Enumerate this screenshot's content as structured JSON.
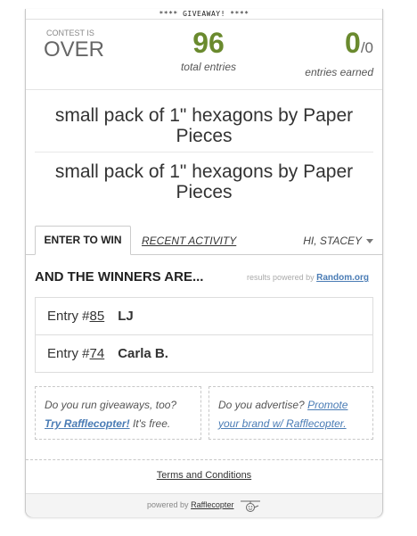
{
  "banner": "**** GIVEAWAY! ****",
  "stats": {
    "status_label": "CONTEST IS",
    "status_value": "OVER",
    "total_entries": "96",
    "total_label": "total entries",
    "earned_value": "0",
    "earned_of": "/0",
    "earned_label": "entries earned"
  },
  "prizes": [
    "small pack of 1\" hexagons by Paper Pieces",
    "small pack of 1\" hexagons by Paper Pieces"
  ],
  "tabs": {
    "enter": "ENTER TO WIN",
    "recent": "RECENT ACTIVITY",
    "user": "HI, STACEY"
  },
  "winners": {
    "title": "AND THE WINNERS ARE...",
    "powered_text": "results powered by",
    "powered_link": "Random.org",
    "entries": [
      {
        "prefix": "Entry #",
        "number": "85",
        "name": "LJ"
      },
      {
        "prefix": "Entry #",
        "number": "74",
        "name": "Carla B."
      }
    ]
  },
  "promo": {
    "left_text": "Do you run giveaways, too?",
    "left_link": "Try Rafflecopter!",
    "left_suffix": "It's free.",
    "right_text": "Do you advertise?",
    "right_link": "Promote your brand w/ Rafflecopter."
  },
  "footer": {
    "terms": "Terms and Conditions",
    "powered_by": "powered by",
    "brand": "Rafflecopter"
  },
  "colors": {
    "accent_green": "#6a8a2e",
    "link_blue": "#4a7cb5"
  }
}
